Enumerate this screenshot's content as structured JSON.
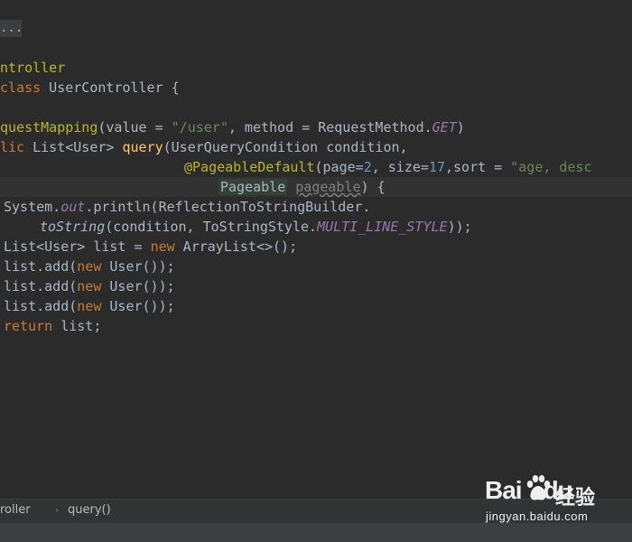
{
  "editor": {
    "fold_placeholder": "...",
    "code_lines": {
      "l1_a": "ntroller",
      "l2_kw": "class",
      "l2_name": " UserController {",
      "l4_ann": "questMapping",
      "l4_open": "(value = ",
      "l4_str": "\"/user\"",
      "l4_mid": ", method = RequestMethod.",
      "l4_field": "GET",
      "l4_close": ")",
      "l5_kw": "lic",
      "l5_type": " List<User> ",
      "l5_fn": "query",
      "l5_rest": "(UserQueryCondition condition,",
      "l6_ann": "@PageableDefault",
      "l6_a": "(page=",
      "l6_n1": "2",
      "l6_b": ", size=",
      "l6_n2": "17",
      "l6_c": ",sort = ",
      "l6_str": "\"age, desc",
      "l7_type": "Pageable",
      "l7_param": "pageable",
      "l7_rest": ") {",
      "l8_a": "System.",
      "l8_field": "out",
      "l8_b": ".println(ReflectionToStringBuilder.",
      "l9_static": "toString",
      "l9_a": "(condition, ToStringStyle.",
      "l9_field": "MULTI_LINE_STYLE",
      "l9_b": "));",
      "l10_a": "List<User> list = ",
      "l10_kw": "new",
      "l10_b": " ArrayList<>();",
      "add_prefix": "list.add(",
      "add_kw": "new",
      "add_suffix": " User());",
      "l14_kw": "return",
      "l14_rest": " list;"
    }
  },
  "breadcrumb": {
    "items": [
      "roller",
      "query()"
    ],
    "separator": "›"
  },
  "watermark": {
    "logo_text": "Bai",
    "logo_suffix": "du",
    "product_name": "经验",
    "domain": "jingyan.baidu.com"
  },
  "colors": {
    "background": "#2b2b2b",
    "keyword": "#cc7832",
    "method": "#ffc66d",
    "string": "#6a8759",
    "number": "#6897bb",
    "annotation": "#bbb529",
    "field": "#9876aa"
  }
}
